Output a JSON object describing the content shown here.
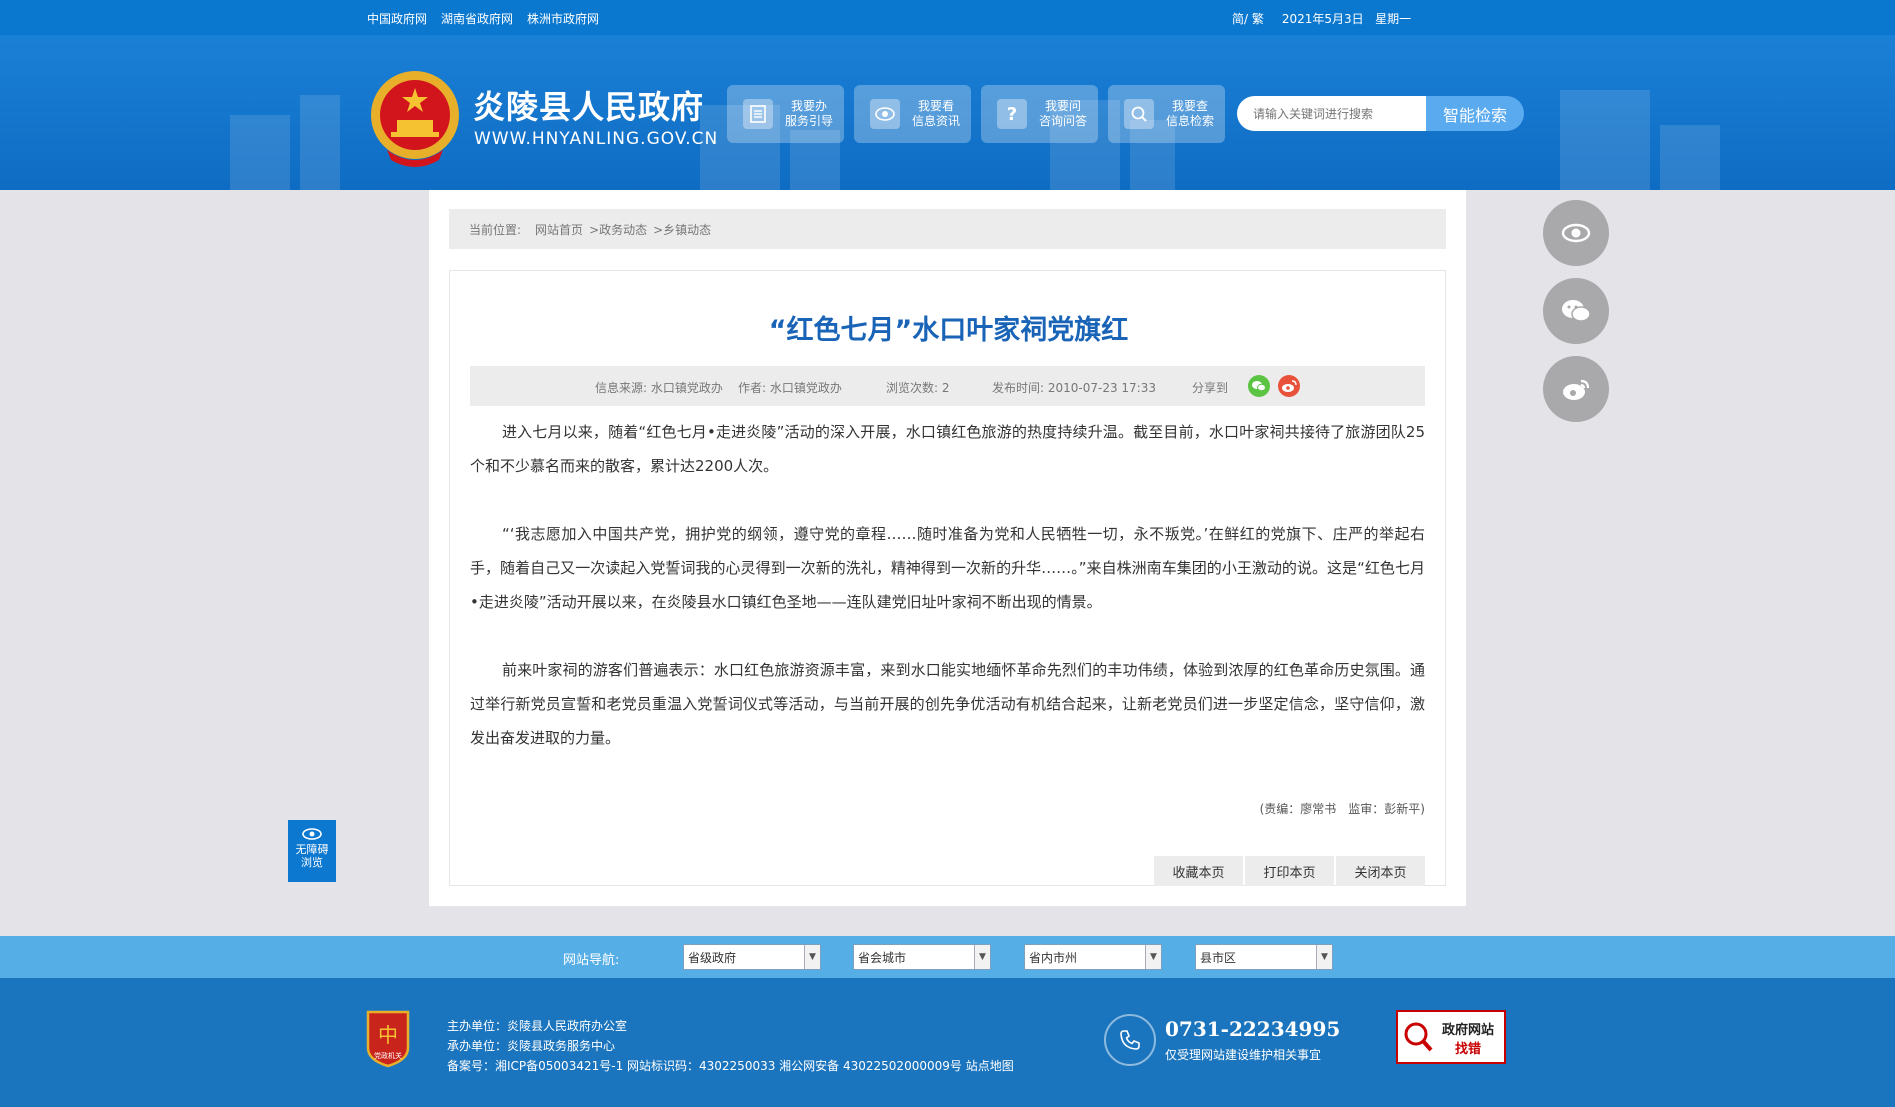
{
  "topbar": {
    "links": [
      "中国政府网",
      "湖南省政府网",
      "株洲市政府网"
    ],
    "lang": "简/ 繁",
    "date": "2021年5月3日",
    "weekday": "星期一"
  },
  "header": {
    "title": "炎陵县人民政府",
    "url": "WWW.HNYANLING.GOV.CN",
    "buttons": [
      {
        "line1": "我要办",
        "line2": "服务引导",
        "icon": "document-icon"
      },
      {
        "line1": "我要看",
        "line2": "信息资讯",
        "icon": "eye-icon"
      },
      {
        "line1": "我要问",
        "line2": "咨询问答",
        "icon": "question-icon"
      },
      {
        "line1": "我要查",
        "line2": "信息检索",
        "icon": "search-icon"
      }
    ],
    "search_placeholder": "请输入关键词进行搜索",
    "search_button": "智能检索"
  },
  "breadcrumb": {
    "prefix": "当前位置:",
    "home": "网站首页",
    "level1": ">政务动态",
    "level2": ">乡镇动态"
  },
  "article": {
    "title": "“红色七月”水口叶家祠党旗红",
    "meta": {
      "source": "信息来源: 水口镇党政办",
      "author": "作者: 水口镇党政办",
      "views": "浏览次数: 2",
      "published": "发布时间: 2010-07-23 17:33",
      "share": "分享到"
    },
    "paragraphs": [
      "进入七月以来，随着“红色七月•走进炎陵”活动的深入开展，水口镇红色旅游的热度持续升温。截至目前，水口叶家祠共接待了旅游团队25个和不少慕名而来的散客，累计达2200人次。",
      "“‘我志愿加入中国共产党，拥护党的纲领，遵守党的章程……随时准备为党和人民牺牲一切，永不叛党。’在鲜红的党旗下、庄严的举起右手，随着自己又一次读起入党誓词我的心灵得到一次新的洗礼，精神得到一次新的升华……。”来自株洲南车集团的小王激动的说。这是“红色七月•走进炎陵”活动开展以来，在炎陵县水口镇红色圣地——连队建党旧址叶家祠不断出现的情景。",
      "前来叶家祠的游客们普遍表示：水口红色旅游资源丰富，来到水口能实地缅怀革命先烈们的丰功伟绩，体验到浓厚的红色革命历史氛围。通过举行新党员宣誓和老党员重温入党誓词仪式等活动，与当前开展的创先争优活动有机结合起来，让新老党员们进一步坚定信念，坚守信仰，激发出奋发进取的力量。"
    ],
    "editor": "(责编：廖常书　监审：彭新平)",
    "actions": [
      "收藏本页",
      "打印本页",
      "关闭本页"
    ]
  },
  "accessibility": {
    "line1": "无障碍",
    "line2": "浏览"
  },
  "footer_nav": {
    "label": "网站导航:",
    "selects": [
      "省级政府",
      "省会城市",
      "省内市州",
      "县市区"
    ]
  },
  "footer": {
    "badge_text": "党政机关",
    "host": "主办单位：炎陵县人民政府办公室",
    "organizer": "承办单位：炎陵县政务服务中心",
    "record": "备案号：湘ICP备05003421号-1 网站标识码：4302250033 湘公网安备 43022502000009号 站点地图",
    "phone": "0731-22234995",
    "phone_sub": "仅受理网站建设维护相关事宜",
    "error_line1": "政府网站",
    "error_line2": "找错"
  },
  "colors": {
    "brand": "#0b78d0",
    "title": "#1a64b8",
    "footer": "#1b75be"
  }
}
